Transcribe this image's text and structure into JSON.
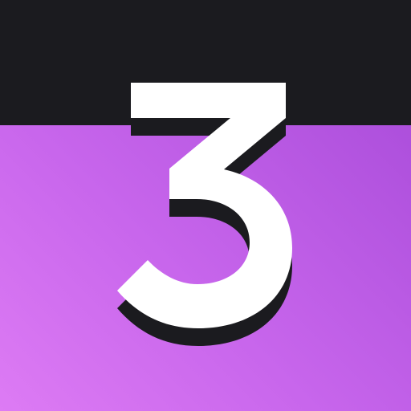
{
  "icon": {
    "glyph": "3",
    "semantic_name": "number-three-icon",
    "colors": {
      "top_band": "#1b1b1f",
      "gradient_start": "#dd7bf4",
      "gradient_end": "#ad4fdc",
      "glyph_fill": "#ffffff",
      "glyph_shadow": "#1b1b1f"
    }
  }
}
